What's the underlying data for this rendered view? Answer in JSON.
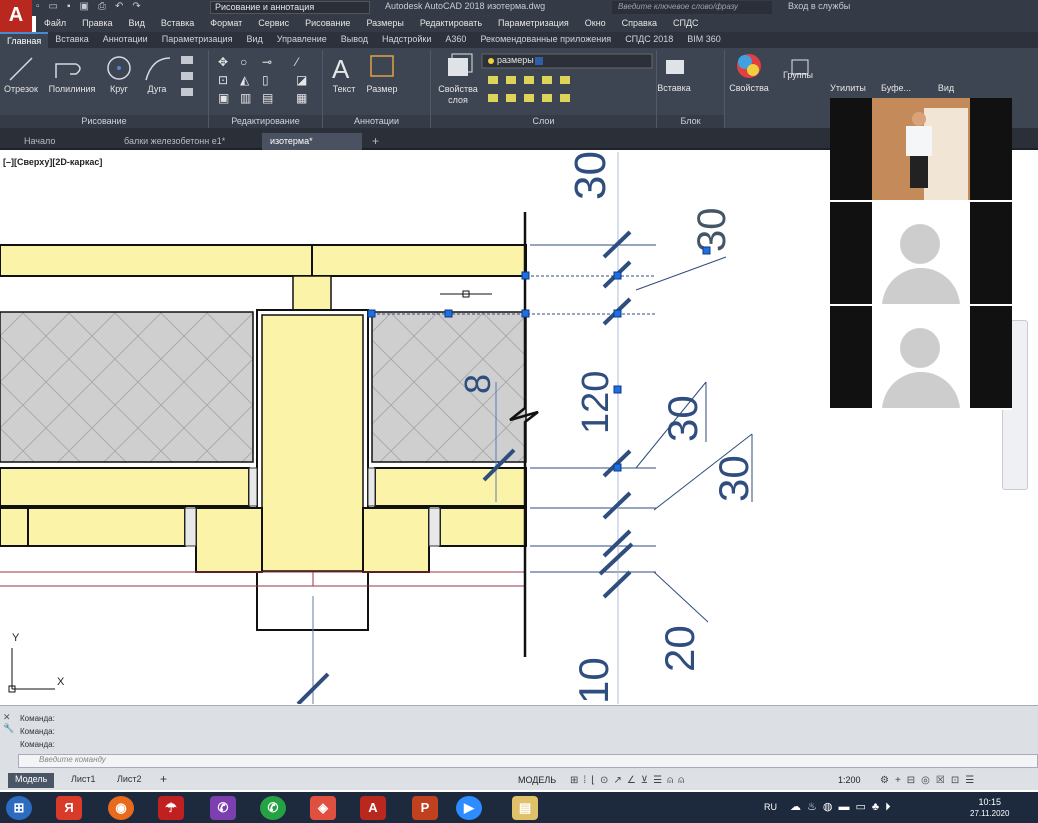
{
  "app": {
    "title": "Autodesk AutoCAD 2018    изотерма.dwg",
    "workspace": "Рисование и аннотация",
    "search_placeholder": "Введите ключевое слово/фразу",
    "signin": "Вход в службы"
  },
  "menu": [
    "Файл",
    "Правка",
    "Вид",
    "Вставка",
    "Формат",
    "Сервис",
    "Рисование",
    "Размеры",
    "Редактировать",
    "Параметризация",
    "Окно",
    "Справка",
    "СПДС"
  ],
  "ribbon_tabs": [
    "Главная",
    "Вставка",
    "Аннотации",
    "Параметризация",
    "Вид",
    "Управление",
    "Вывод",
    "Надстройки",
    "A360",
    "Рекомендованные приложения",
    "СПДС 2018",
    "BIM 360"
  ],
  "ribbon": {
    "tools": {
      "line": "Отрезок",
      "polyline": "Полилиния",
      "circle": "Круг",
      "arc": "Дуга",
      "text": "Текст",
      "dimension": "Размер",
      "layer_props": "Свойства слоя",
      "insert": "Вставка",
      "properties": "Свойства",
      "groups": "Группы",
      "utilities": "Утилиты",
      "clipboard": "Буфе...",
      "view": "Вид"
    },
    "layer_name": "размеры",
    "panels": {
      "draw": "Рисование",
      "modify": "Редактирование",
      "annotation": "Аннотации",
      "layers": "Слои",
      "block": "Блок"
    }
  },
  "file_tabs": [
    "Начало",
    "балки железобетонн e1*",
    "изотерма*"
  ],
  "viewport_label": "[–][Сверху][2D-каркас]",
  "drawing": {
    "dims": [
      "30",
      "30",
      "8",
      "120",
      "30",
      "30",
      "20",
      "10"
    ]
  },
  "ucs": {
    "y": "Y",
    "x": "X"
  },
  "command": {
    "history": [
      "Команда:",
      "Команда:",
      "Команда:"
    ],
    "placeholder": "Введите команду"
  },
  "layout_tabs": [
    "Модель",
    "Лист1",
    "Лист2"
  ],
  "status": {
    "mode": "МОДЕЛЬ",
    "scale": "1:200"
  },
  "taskbar": {
    "lang": "RU",
    "time": "10:15",
    "date": "27.11.2020"
  },
  "colors": {
    "accent": "#4a8ad4",
    "fill": "#fbf4a8",
    "insulation": "#cfcfcf",
    "dim": "#2f4d7e"
  }
}
